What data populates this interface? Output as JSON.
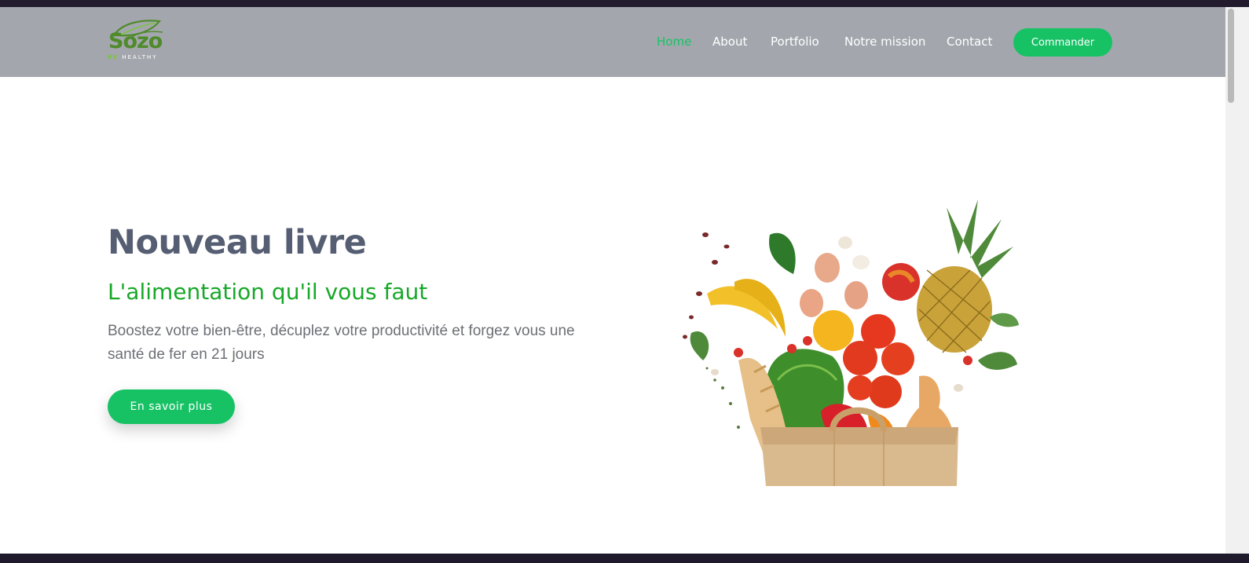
{
  "brand": {
    "name": "Sozo",
    "tagline_be": "BE",
    "tagline_healthy": "HEALTHY"
  },
  "nav": {
    "items": [
      {
        "label": "Home",
        "active": true
      },
      {
        "label": "About",
        "active": false
      },
      {
        "label": "Portfolio",
        "active": false
      },
      {
        "label": "Notre mission",
        "active": false
      },
      {
        "label": "Contact",
        "active": false
      }
    ],
    "cta_label": "Commander"
  },
  "hero": {
    "title": "Nouveau livre",
    "subtitle": "L'alimentation qu'il vous faut",
    "description": "Boostez votre bien-être, décuplez votre productivité et forgez vous une santé de fer en 21 jours",
    "cta_label": "En savoir plus",
    "image_icon": "grocery-bag-icon"
  },
  "colors": {
    "accent": "#17c265",
    "subtitle_green": "#17a828",
    "navbar_bg": "#a3a7ad",
    "title_color": "#555e72"
  }
}
